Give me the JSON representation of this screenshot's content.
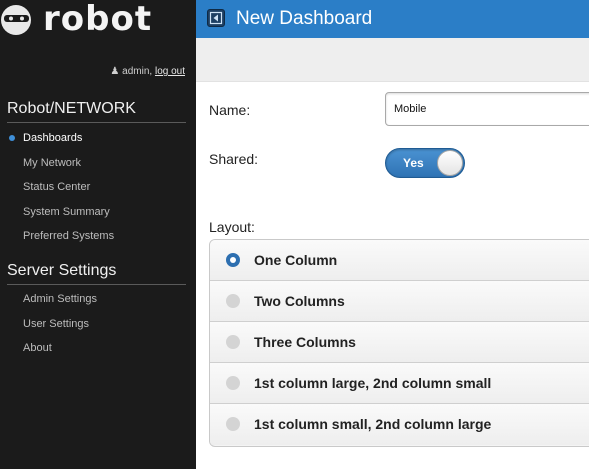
{
  "brand": {
    "logo_text": "robot"
  },
  "user": {
    "name": "admin,",
    "logout_label": "log out",
    "user_icon": "user-icon"
  },
  "sidebar": {
    "sections": [
      {
        "title": "Robot/NETWORK",
        "items": [
          {
            "label": "Dashboards",
            "active": true
          },
          {
            "label": "My Network"
          },
          {
            "label": "Status Center"
          },
          {
            "label": "System Summary"
          },
          {
            "label": "Preferred Systems"
          }
        ]
      },
      {
        "title": "Server Settings",
        "items": [
          {
            "label": "Admin Settings"
          },
          {
            "label": "User Settings"
          },
          {
            "label": "About"
          }
        ]
      }
    ]
  },
  "header": {
    "title": "New Dashboard",
    "back_icon": "back-arrow-icon"
  },
  "form": {
    "name_label": "Name:",
    "name_value": "Mobile",
    "shared_label": "Shared:",
    "shared_toggle_label": "Yes",
    "shared_on": true,
    "layout_label": "Layout:",
    "layout_options": [
      {
        "label": "One Column",
        "selected": true
      },
      {
        "label": "Two Columns",
        "selected": false
      },
      {
        "label": "Three Columns",
        "selected": false
      },
      {
        "label": "1st column large, 2nd column small",
        "selected": false
      },
      {
        "label": "1st column small, 2nd column large",
        "selected": false
      }
    ]
  },
  "colors": {
    "accent": "#2b7ec7",
    "sidebar_bg": "#1b1b1b",
    "active_dot": "#3f8fd8",
    "radio_selected": "#2d6fb0"
  }
}
